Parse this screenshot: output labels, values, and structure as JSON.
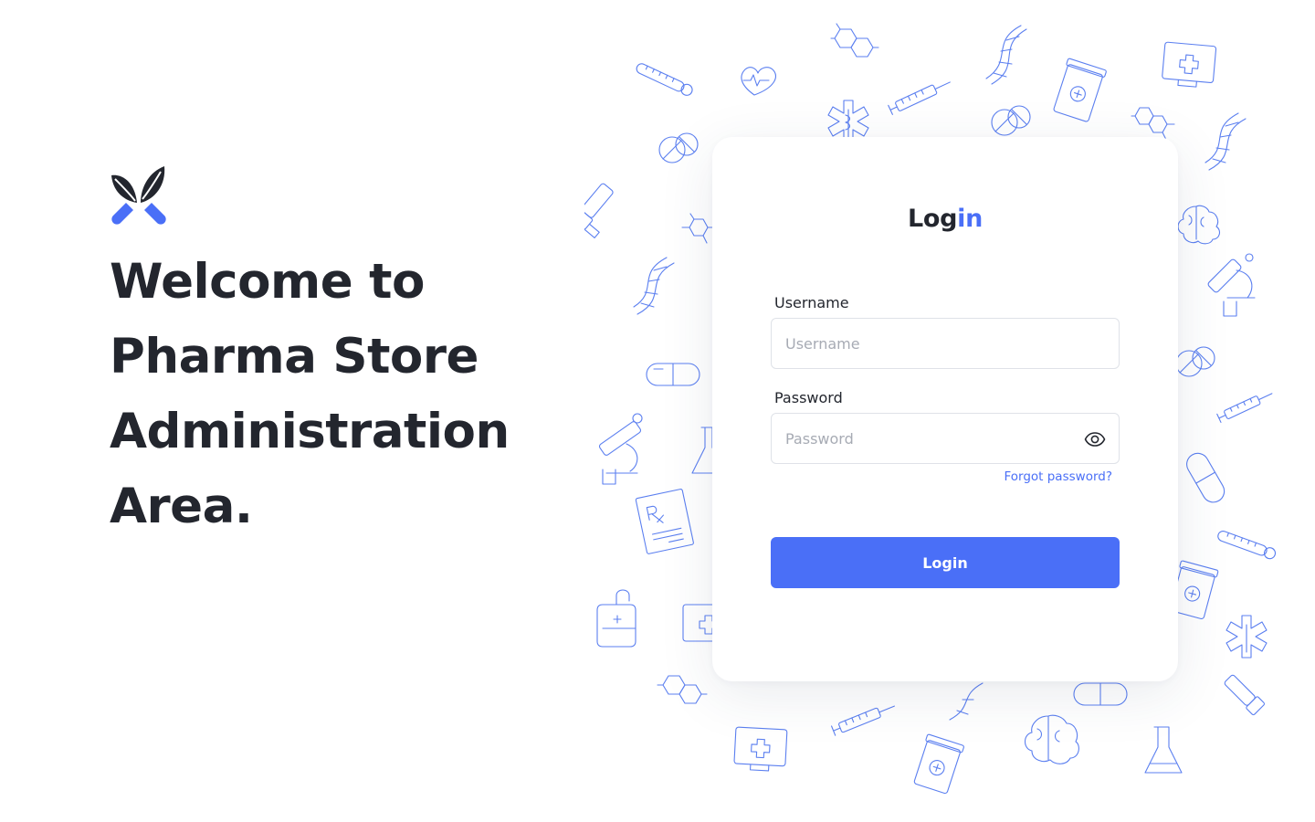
{
  "hero": {
    "logo_icon": "leaf-capsule-logo",
    "heading_lines": [
      "Welcome to",
      "Pharma Store",
      "Administration",
      "Area."
    ]
  },
  "login": {
    "title_main": "Log",
    "title_accent": "in",
    "username_label": "Username",
    "username_placeholder": "Username",
    "username_value": "",
    "password_label": "Password",
    "password_placeholder": "Password",
    "password_value": "",
    "password_toggle_icon": "eye-icon",
    "forgot_label": "Forgot password?",
    "submit_label": "Login"
  },
  "colors": {
    "accent": "#4a6ff7",
    "text": "#23262e",
    "placeholder": "#a7abb4",
    "doodle": "#5b7ff0"
  },
  "background": {
    "doodle_icons": [
      "thermometer-icon",
      "heart-icon",
      "molecule-icon",
      "syringe-icon",
      "dna-icon",
      "pill-bottle-icon",
      "first-aid-monitor-icon",
      "pills-icon",
      "medical-star-icon",
      "inhaler-icon",
      "brain-icon",
      "microscope-icon",
      "capsule-icon",
      "flask-icon",
      "prescription-icon",
      "iv-bag-icon"
    ]
  }
}
